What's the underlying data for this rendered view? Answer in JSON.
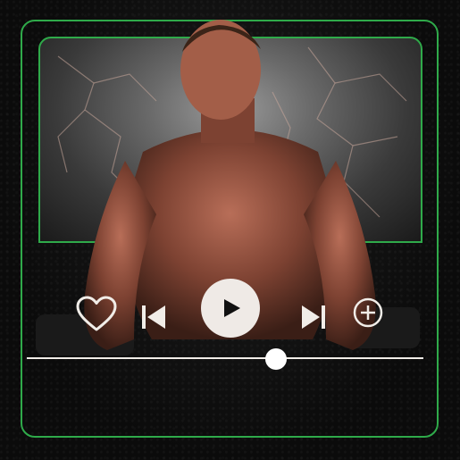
{
  "player": {
    "artwork_icon": "athlete-with-dumbbells-image",
    "liked": false,
    "progress": 0.628,
    "accent_color": "#2faa4a",
    "controls": [
      {
        "id": "like",
        "icon": "heart-outline-icon"
      },
      {
        "id": "previous",
        "icon": "skip-previous-icon"
      },
      {
        "id": "play",
        "icon": "play-icon"
      },
      {
        "id": "next",
        "icon": "skip-next-icon"
      },
      {
        "id": "add",
        "icon": "plus-circle-icon"
      }
    ]
  }
}
